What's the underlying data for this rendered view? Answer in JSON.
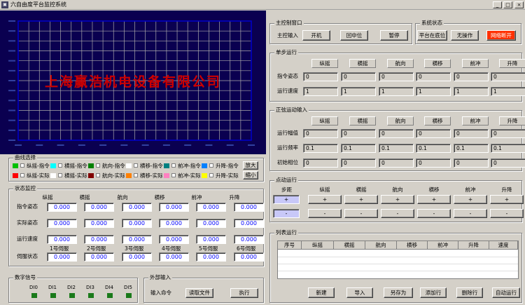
{
  "window": {
    "title": "六自由度平台监控系统",
    "icon": "app-icon"
  },
  "chart": {
    "watermark": "上海赢浩机电设备有限公司",
    "bg": "#0a0050",
    "grid": "#aaaaaa",
    "frame": "#0000cc"
  },
  "curve_select": {
    "title": "曲线选择",
    "rows": [
      [
        {
          "label": "纵摇-指令",
          "color": "#00c000"
        },
        {
          "label": "横摇-指令",
          "color": "#00ffff"
        },
        {
          "label": "航向-指令",
          "color": "#008000"
        },
        {
          "label": "横移-指令",
          "color": "#ffffff"
        },
        {
          "label": "前冲-指令",
          "color": "#008080"
        },
        {
          "label": "升降-指令",
          "color": "#0080ff"
        }
      ],
      [
        {
          "label": "纵摇-实际",
          "color": "#ff0000"
        },
        {
          "label": "横摇-实际",
          "color": "#ffffff"
        },
        {
          "label": "航向-实际",
          "color": "#800000"
        },
        {
          "label": "横移-实际",
          "color": "#ff8000"
        },
        {
          "label": "前冲-实际",
          "color": "#ff80c0"
        },
        {
          "label": "升降-实际",
          "color": "#ffff00"
        }
      ]
    ],
    "zoom_in": "放大",
    "zoom_out": "缩小"
  },
  "status": {
    "title": "状态监控",
    "cols": [
      "纵摇",
      "横摇",
      "航向",
      "横移",
      "前冲",
      "升降"
    ],
    "rows": [
      {
        "label": "指令姿态",
        "values": [
          "0.000",
          "0.000",
          "0.000",
          "0.000",
          "0.000",
          "0.000"
        ]
      },
      {
        "label": "实际姿态",
        "values": [
          "0.000",
          "0.000",
          "0.000",
          "0.000",
          "0.000",
          "0.000"
        ]
      },
      {
        "label": "运行速度",
        "values": [
          "0.000",
          "0.000",
          "0.000",
          "0.000",
          "0.000",
          "0.000"
        ]
      },
      {
        "label": "伺服状态",
        "values": [
          "0.000",
          "0.000",
          "0.000",
          "0.000",
          "0.000",
          "0.000"
        ]
      }
    ],
    "servos": [
      "1号伺服",
      "2号伺服",
      "3号伺服",
      "4号伺服",
      "5号伺服",
      "6号伺服"
    ]
  },
  "digital": {
    "title": "数字信号",
    "items": [
      "DI0",
      "DI1",
      "DI2",
      "DI3",
      "DI4",
      "DI5"
    ],
    "led_color": "#1a7a1a"
  },
  "ext_input": {
    "title": "外部输入",
    "label": "输入命令",
    "read": "读取文件",
    "exec": "执行"
  },
  "main_ctrl": {
    "title": "主控制窗口",
    "label": "主控输入",
    "buttons": [
      "开机",
      "回中位",
      "暂停"
    ]
  },
  "sys_state": {
    "title": "系统状态",
    "items": [
      "平台在底位",
      "无操作",
      "网络断开"
    ],
    "alarm_color": "#ff3000"
  },
  "single_step": {
    "title": "单步运行",
    "cols": [
      "纵摇",
      "横摇",
      "航向",
      "横移",
      "前冲",
      "升降"
    ],
    "rows": [
      {
        "label": "指令姿态",
        "values": [
          "0",
          "0",
          "0",
          "0",
          "0",
          "0"
        ]
      },
      {
        "label": "运行速度",
        "values": [
          "1",
          "1",
          "1",
          "1",
          "1",
          "1"
        ]
      }
    ]
  },
  "sine": {
    "title": "正弦运动输入",
    "cols": [
      "纵摇",
      "横摇",
      "航向",
      "横移",
      "前冲",
      "升降"
    ],
    "rows": [
      {
        "label": "运行幅值",
        "values": [
          "0",
          "0",
          "0",
          "0",
          "0",
          "0"
        ]
      },
      {
        "label": "运行频率",
        "values": [
          "0.1",
          "0.1",
          "0.1",
          "0.1",
          "0.1",
          "0.1"
        ]
      },
      {
        "label": "初始相位",
        "values": [
          "0",
          "0",
          "0",
          "0",
          "0",
          "0"
        ]
      }
    ]
  },
  "jog": {
    "title": "点动运行",
    "step_label": "步距",
    "cols": [
      "纵摇",
      "横摇",
      "航向",
      "横移",
      "前冲",
      "升降"
    ],
    "plus": "+",
    "minus": "-"
  },
  "list_run": {
    "title": "列表运行",
    "cols": [
      "序号",
      "纵摇",
      "横摇",
      "航向",
      "横移",
      "前冲",
      "升降",
      "速度"
    ],
    "buttons": [
      "新建",
      "导入",
      "另存为",
      "添加行",
      "删除行",
      "自动运行"
    ]
  }
}
